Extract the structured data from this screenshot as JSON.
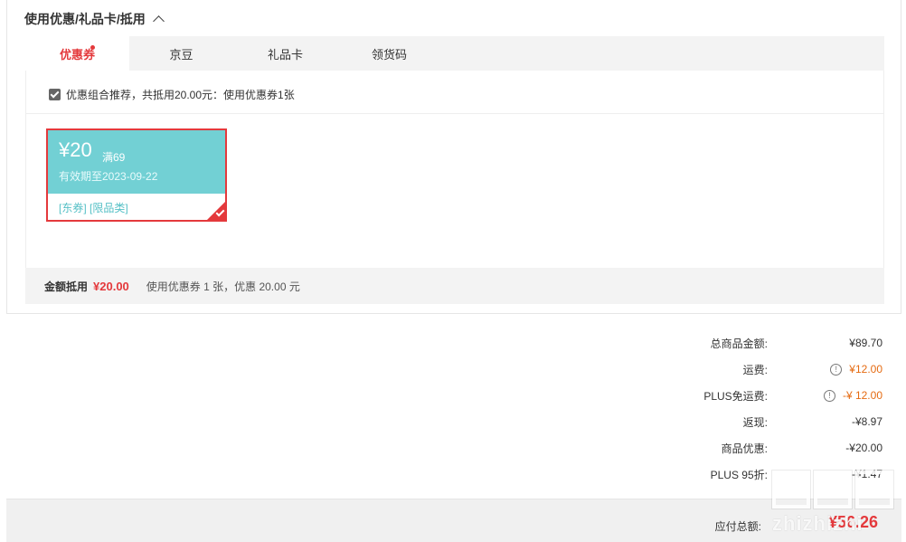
{
  "section": {
    "title": "使用优惠/礼品卡/抵用"
  },
  "tabs": [
    {
      "label": "优惠券"
    },
    {
      "label": "京豆"
    },
    {
      "label": "礼品卡"
    },
    {
      "label": "领货码"
    }
  ],
  "recommend": {
    "text": "优惠组合推荐，共抵用20.00元：使用优惠券1张"
  },
  "coupon": {
    "amount": "¥20",
    "condition": "满69",
    "expiry": "有效期至2023-09-22",
    "tags": "[东券]  [限品类]"
  },
  "footer": {
    "label": "金额抵用",
    "amount": "¥20.00",
    "desc": "使用优惠券 1 张，优惠 20.00 元"
  },
  "summary": {
    "rows": [
      {
        "label": "总商品金额:",
        "value": "¥89.70"
      },
      {
        "label": "运费:",
        "value": "¥12.00"
      },
      {
        "label": "PLUS免运费:",
        "value": "-¥ 12.00"
      },
      {
        "label": "返现:",
        "value": "-¥8.97"
      },
      {
        "label": "商品优惠:",
        "value": "-¥20.00"
      },
      {
        "label": "PLUS 95折:",
        "value": "-¥1.47"
      }
    ],
    "pay_label": "应付总额:",
    "pay_total": "¥56.26"
  },
  "watermark": {
    "text": "zhizhizhi"
  },
  "colors": {
    "accent": "#e4393c",
    "coupon": "#72d0d4",
    "orange": "#e56b12"
  }
}
